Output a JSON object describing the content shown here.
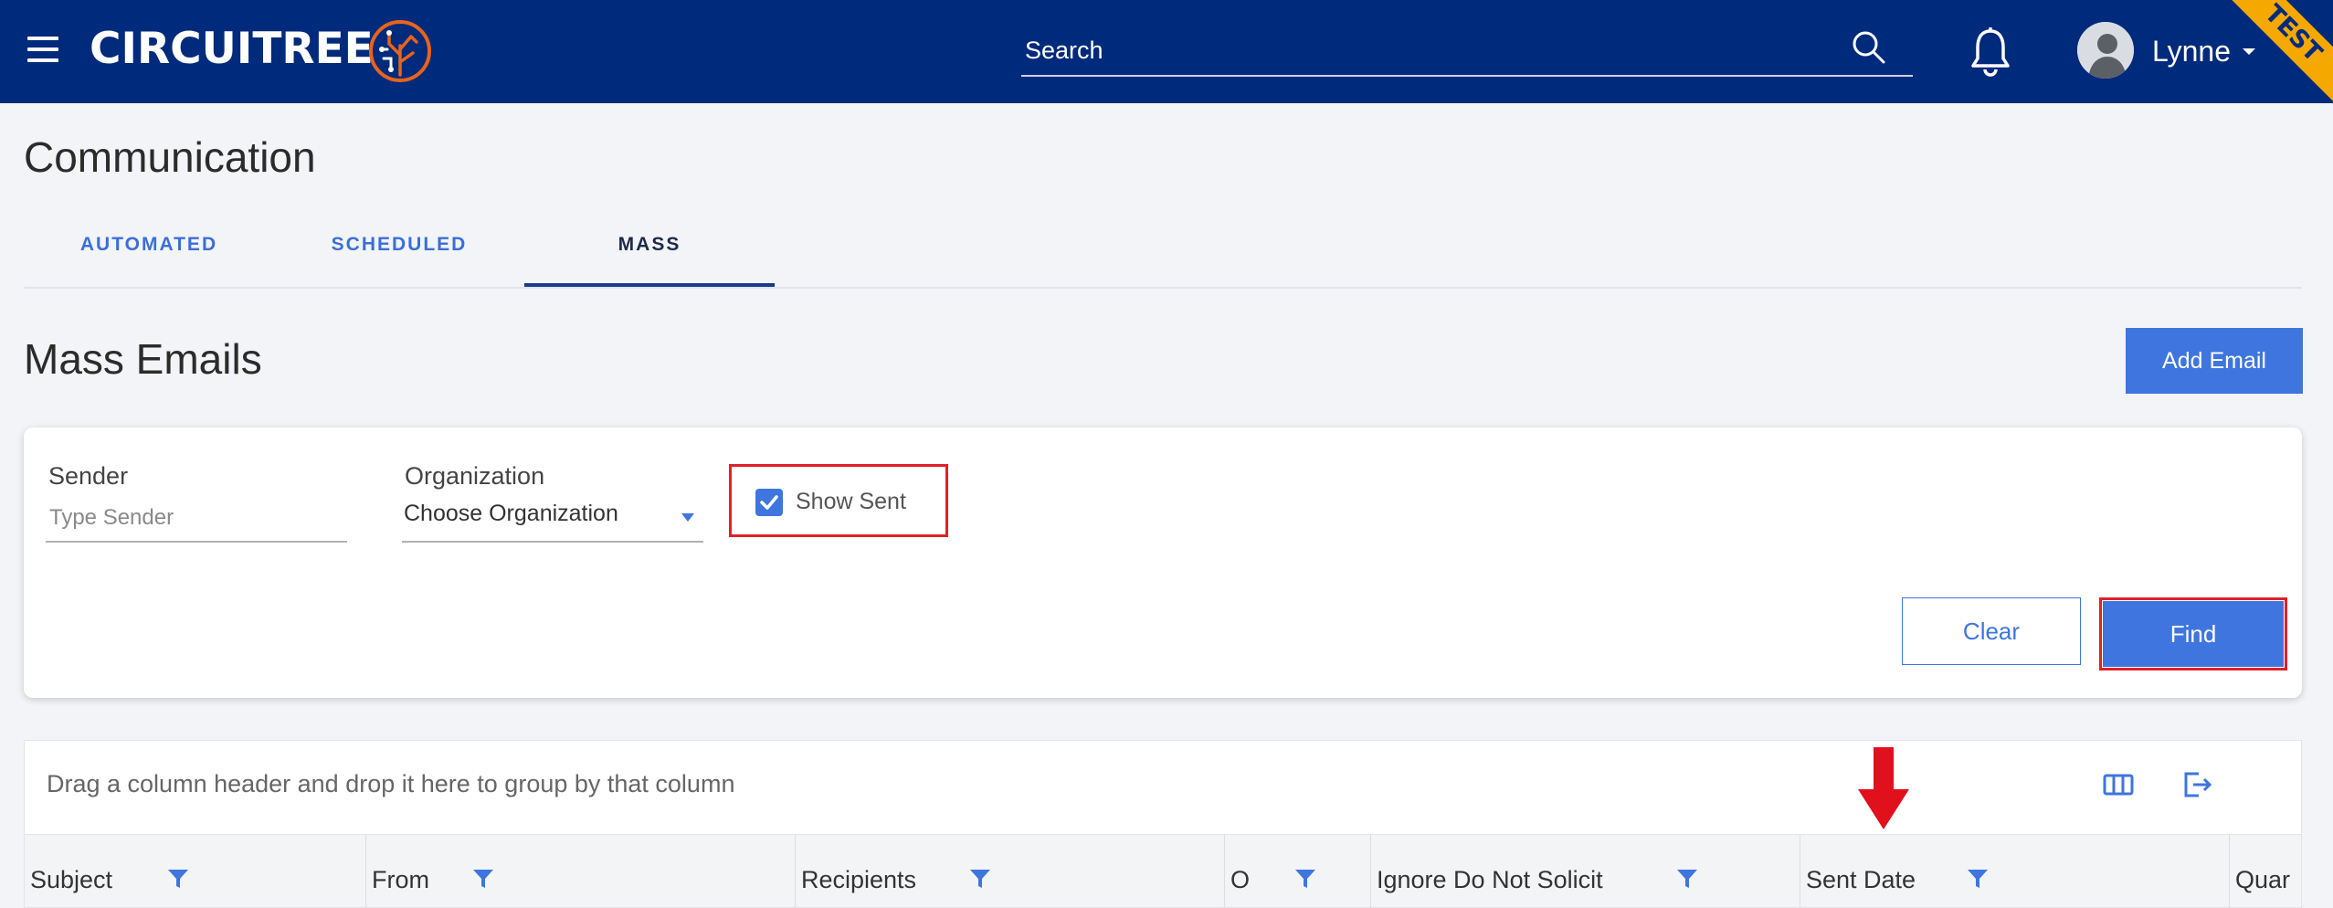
{
  "header": {
    "logo_text": "CIRCUITREE",
    "search_placeholder": "Search",
    "user_name": "Lynne",
    "environment_badge": "TEST",
    "brand_color": "#002a7b",
    "accent_color": "#e8641c",
    "badge_color": "#f5a800",
    "icons": [
      "menu-icon",
      "search-icon",
      "bell-icon",
      "avatar",
      "caret-down-icon"
    ]
  },
  "page": {
    "title": "Communication",
    "tabs": [
      {
        "label": "AUTOMATED",
        "active": false
      },
      {
        "label": "SCHEDULED",
        "active": false
      },
      {
        "label": "MASS",
        "active": true
      }
    ]
  },
  "section": {
    "title": "Mass Emails",
    "add_button": "Add Email",
    "primary_color": "#3f75de"
  },
  "filters": {
    "sender_label": "Sender",
    "sender_placeholder": "Type Sender",
    "sender_value": "",
    "organization_label": "Organization",
    "organization_value": "Choose Organization",
    "show_sent_label": "Show Sent",
    "show_sent_checked": true,
    "clear_button": "Clear",
    "find_button": "Find",
    "highlight_color": "#e0202a"
  },
  "grid": {
    "group_hint": "Drag a column header and drop it here to group by that column",
    "tools": [
      "columns-icon",
      "export-icon"
    ],
    "columns": [
      {
        "label": "Subject",
        "filter": true
      },
      {
        "label": "From",
        "filter": true
      },
      {
        "label": "Recipients",
        "filter": true
      },
      {
        "label": "O",
        "filter": true
      },
      {
        "label": "Ignore Do Not Solicit",
        "filter": true
      },
      {
        "label": "Sent Date",
        "filter": true
      },
      {
        "label": "Quar",
        "filter": false
      }
    ]
  },
  "annotation": {
    "arrow_icon": "red-down-arrow-icon"
  }
}
